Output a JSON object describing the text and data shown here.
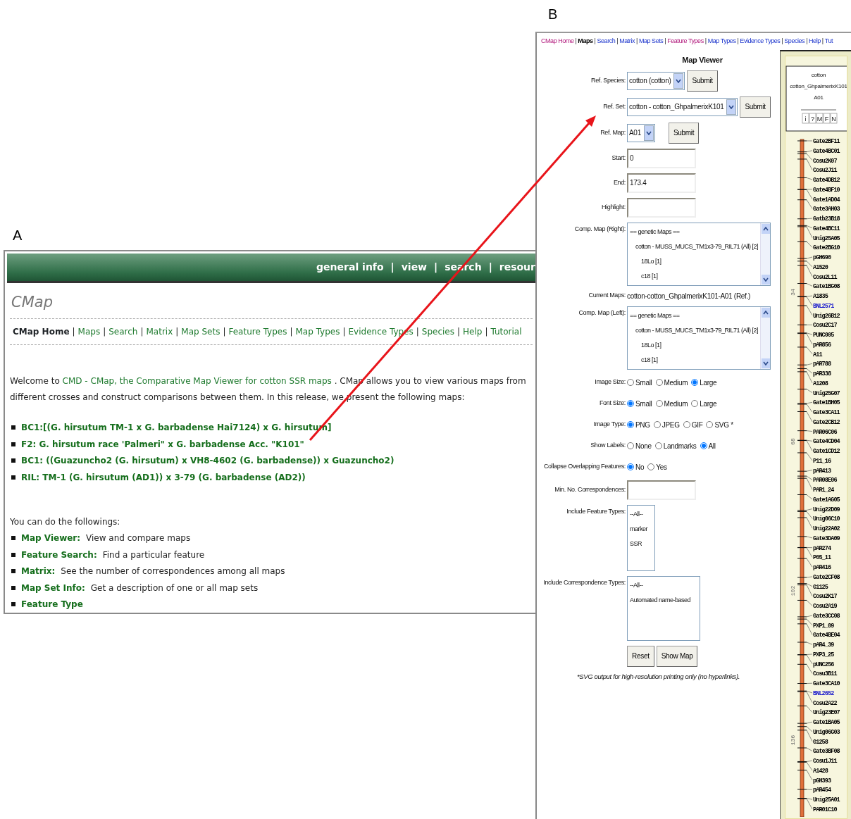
{
  "panel_a": {
    "label": "A",
    "header_nav": {
      "separator": "|",
      "items": [
        "general info",
        "view",
        "search",
        "resour"
      ]
    },
    "title": "CMap",
    "nav": {
      "separator": "|",
      "items": [
        {
          "text": "CMap Home",
          "selected": true
        },
        {
          "text": "Maps",
          "selected": false
        },
        {
          "text": "Search",
          "selected": false
        },
        {
          "text": "Matrix",
          "selected": false
        },
        {
          "text": "Map Sets",
          "selected": false
        },
        {
          "text": "Feature Types",
          "selected": false
        },
        {
          "text": "Map Types",
          "selected": false
        },
        {
          "text": "Evidence Types",
          "selected": false
        },
        {
          "text": "Species",
          "selected": false
        },
        {
          "text": "Help",
          "selected": false
        },
        {
          "text": "Tutorial",
          "selected": false
        }
      ]
    },
    "welcome": {
      "before": "Welcome to ",
      "link": "CMD - CMap, the Comparative Map Viewer for cotton SSR maps",
      "after": " . CMap allows you to view various maps from different crosses and construct comparisons between them. In this release, we present the following maps:"
    },
    "maps": [
      "BC1:[(G. hirsutum TM-1 x G. barbadense Hai7124) x G. hirsutum]",
      "F2: G. hirsutum race 'Palmeri\" x G. barbadense Acc. \"K101\"",
      "BC1: ((Guazuncho2 (G. hirsutum) x VH8-4602 (G. barbadense)) x Guazuncho2)",
      "RIL: TM-1 (G. hirsutum (AD1)) x 3-79 (G. barbadense (AD2))"
    ],
    "intro": "You can do the followings:",
    "features": [
      {
        "link": "Map Viewer:",
        "text": "View and compare maps"
      },
      {
        "link": "Feature Search:",
        "text": "Find a particular feature"
      },
      {
        "link": "Matrix:",
        "text": "See the number of correspondences among all maps"
      },
      {
        "link": "Map Set Info:",
        "text": "Get a description of one or all map sets"
      },
      {
        "link": "Feature Type"
      }
    ]
  },
  "panel_b": {
    "label": "B",
    "nav": {
      "separator": "|",
      "items": [
        {
          "text": "CMap Home",
          "kind": "visited"
        },
        {
          "text": "Maps",
          "kind": "current"
        },
        {
          "text": "Search",
          "kind": "link"
        },
        {
          "text": "Matrix",
          "kind": "link"
        },
        {
          "text": "Map Sets",
          "kind": "link"
        },
        {
          "text": "Feature Types",
          "kind": "visited"
        },
        {
          "text": "Map Types",
          "kind": "link"
        },
        {
          "text": "Evidence Types",
          "kind": "link"
        },
        {
          "text": "Species",
          "kind": "link"
        },
        {
          "text": "Help",
          "kind": "link"
        },
        {
          "text": "Tut",
          "kind": "link"
        }
      ]
    },
    "form": {
      "title": "Map Viewer",
      "rows": [
        {
          "kind": "select",
          "label": "Ref. Species:",
          "value": "cotton (cotton)",
          "button": "Submit"
        },
        {
          "kind": "select",
          "label": "Ref. Set:",
          "value": "cotton - cotton_GhpalmerixK101",
          "button": "Submit"
        },
        {
          "kind": "select",
          "label": "Ref. Map:",
          "value": "A01",
          "button": "Submit"
        },
        {
          "kind": "input",
          "label": "Start:",
          "value": "0"
        },
        {
          "kind": "input",
          "label": "End:",
          "value": "173.4"
        },
        {
          "kind": "input",
          "label": "Highlight:"
        },
        {
          "kind": "listbox",
          "label": "Comp. Map (Right):",
          "scrollbar": true,
          "options": [
            {
              "text": "== genetic Maps ==",
              "children": [
                {
                  "text": "cotton - MUSS_MUCS_TM1x3-79_RIL71 (All) [2]",
                  "children": [
                    {
                      "text": "18Lo [1]"
                    },
                    {
                      "text": "c18 [1]"
                    }
                  ]
                }
              ]
            }
          ]
        },
        {
          "kind": "text",
          "label": "Current Maps:",
          "value": "cotton-cotton_GhpalmerixK101-A01 (Ref.)"
        },
        {
          "kind": "listbox",
          "label": "Comp. Map (Left):",
          "scrollbar": true,
          "options": [
            {
              "text": "== genetic Maps ==",
              "children": [
                {
                  "text": "cotton - MUSS_MUCS_TM1x3-79_RIL71 (All) [2]",
                  "children": [
                    {
                      "text": "18Lo [1]"
                    },
                    {
                      "text": "c18 [1]"
                    }
                  ]
                }
              ]
            }
          ]
        },
        {
          "kind": "radios",
          "label": "Image Size:",
          "options": [
            {
              "text": "Small",
              "selected": false
            },
            {
              "text": "Medium",
              "selected": false
            },
            {
              "text": "Large",
              "selected": true
            }
          ]
        },
        {
          "kind": "radios",
          "label": "Font Size:",
          "options": [
            {
              "text": "Small",
              "selected": true
            },
            {
              "text": "Medium",
              "selected": false
            },
            {
              "text": "Large",
              "selected": false
            }
          ]
        },
        {
          "kind": "radios",
          "label": "Image Type:",
          "options": [
            {
              "text": "PNG",
              "selected": true
            },
            {
              "text": "JPEG",
              "selected": false
            },
            {
              "text": "GIF",
              "selected": false
            },
            {
              "text": "SVG *",
              "selected": false
            }
          ]
        },
        {
          "kind": "radios",
          "label": "Show Labels:",
          "options": [
            {
              "text": "None",
              "selected": false
            },
            {
              "text": "Landmarks",
              "selected": false
            },
            {
              "text": "All",
              "selected": true
            }
          ]
        },
        {
          "kind": "radios",
          "label": "Collapse Overlapping Features:",
          "options": [
            {
              "text": "No",
              "selected": true
            },
            {
              "text": "Yes",
              "selected": false
            }
          ]
        },
        {
          "kind": "input",
          "label": "Min. No. Correspondences:"
        },
        {
          "kind": "listbox",
          "label": "Include Feature Types:",
          "scrollbar": false,
          "options": [
            {
              "text": "--All--"
            },
            {
              "text": "marker"
            },
            {
              "text": "SSR"
            }
          ]
        },
        {
          "kind": "listbox",
          "label": "Include Correspondence Types:",
          "scrollbar": false,
          "options": [
            {
              "text": "--All--"
            },
            {
              "text": "Automated name-based"
            }
          ]
        },
        {
          "kind": "buttons",
          "buttons": [
            "Reset",
            "Show Map"
          ]
        },
        {
          "kind": "note",
          "text": "*SVG output for high-resolution printing only (no hyperlinks)."
        }
      ]
    },
    "map": {
      "header": [
        "cotton",
        "cotton_GhpalmerixK101",
        "A01"
      ],
      "buttons": [
        "i",
        "?",
        "M",
        "F",
        "N"
      ],
      "scale_labels": [
        "34",
        "68",
        "102",
        "136"
      ],
      "features": [
        {
          "name": "Gate2BF11",
          "color": "#000000"
        },
        {
          "name": "Gate4BC01",
          "color": "#000000"
        },
        {
          "name": "Cosu2K07",
          "color": "#000000"
        },
        {
          "name": "Cosu2J11",
          "color": "#000000"
        },
        {
          "name": "Gate4DB12",
          "color": "#000000"
        },
        {
          "name": "Gate4BF10",
          "color": "#000000"
        },
        {
          "name": "Gate1AD04",
          "color": "#000000"
        },
        {
          "name": "Gate3AH03",
          "color": "#000000"
        },
        {
          "name": "Gatb23B18",
          "color": "#000000"
        },
        {
          "name": "Gate4BC11",
          "color": "#000000"
        },
        {
          "name": "Unig25A05",
          "color": "#000000"
        },
        {
          "name": "Gate2BG10",
          "color": "#000000"
        },
        {
          "name": "pGH690",
          "color": "#000000"
        },
        {
          "name": "A1520",
          "color": "#000000"
        },
        {
          "name": "Cosu2L11",
          "color": "#000000"
        },
        {
          "name": "Gate1BG08",
          "color": "#000000"
        },
        {
          "name": "A1835",
          "color": "#000000"
        },
        {
          "name": "BNL2571",
          "color": "#1a1acc"
        },
        {
          "name": "Unig26B12",
          "color": "#000000"
        },
        {
          "name": "Cosu2C17",
          "color": "#000000"
        },
        {
          "name": "PUNC005",
          "color": "#000000"
        },
        {
          "name": "pAR856",
          "color": "#000000"
        },
        {
          "name": "A11",
          "color": "#000000"
        },
        {
          "name": "pAR788",
          "color": "#000000"
        },
        {
          "name": "pAR338",
          "color": "#000000"
        },
        {
          "name": "A1208",
          "color": "#000000"
        },
        {
          "name": "Unig25G07",
          "color": "#000000"
        },
        {
          "name": "Gate1BH05",
          "color": "#000000"
        },
        {
          "name": "Gate3CA11",
          "color": "#000000"
        },
        {
          "name": "Gate2CB12",
          "color": "#000000"
        },
        {
          "name": "PAR06C06",
          "color": "#000000"
        },
        {
          "name": "Gate4CD04",
          "color": "#000000"
        },
        {
          "name": "Gate1CD12",
          "color": "#000000"
        },
        {
          "name": "P11_16",
          "color": "#000000"
        },
        {
          "name": "pAR413",
          "color": "#000000"
        },
        {
          "name": "PAR08E06",
          "color": "#000000"
        },
        {
          "name": "PAR1_24",
          "color": "#000000"
        },
        {
          "name": "Gate1AG05",
          "color": "#000000"
        },
        {
          "name": "Unig22D09",
          "color": "#000000"
        },
        {
          "name": "Unig06C10",
          "color": "#000000"
        },
        {
          "name": "Unig22A02",
          "color": "#000000"
        },
        {
          "name": "Gate3DA09",
          "color": "#000000"
        },
        {
          "name": "pAR274",
          "color": "#000000"
        },
        {
          "name": "P05_11",
          "color": "#000000"
        },
        {
          "name": "pAR416",
          "color": "#000000"
        },
        {
          "name": "Gate2CF08",
          "color": "#000000"
        },
        {
          "name": "G1125",
          "color": "#000000"
        },
        {
          "name": "Cosu2K17",
          "color": "#000000"
        },
        {
          "name": "Cosu2A19",
          "color": "#000000"
        },
        {
          "name": "Gate3CC08",
          "color": "#000000"
        },
        {
          "name": "PXP1_09",
          "color": "#000000"
        },
        {
          "name": "Gate4BE04",
          "color": "#000000"
        },
        {
          "name": "pAR4_39",
          "color": "#000000"
        },
        {
          "name": "PXP3_25",
          "color": "#000000"
        },
        {
          "name": "pUNC256",
          "color": "#000000"
        },
        {
          "name": "Cosu3B11",
          "color": "#000000"
        },
        {
          "name": "Gate3CA10",
          "color": "#000000"
        },
        {
          "name": "BNL2652",
          "color": "#1a1acc"
        },
        {
          "name": "Cosu2A22",
          "color": "#000000"
        },
        {
          "name": "Unig23E07",
          "color": "#000000"
        },
        {
          "name": "Gate1BA05",
          "color": "#000000"
        },
        {
          "name": "Unig06G03",
          "color": "#000000"
        },
        {
          "name": "G1258",
          "color": "#000000"
        },
        {
          "name": "Gate3BF08",
          "color": "#000000"
        },
        {
          "name": "Cosu1J11",
          "color": "#000000"
        },
        {
          "name": "A1428",
          "color": "#000000"
        },
        {
          "name": "pGH393",
          "color": "#000000"
        },
        {
          "name": "pAR454",
          "color": "#000000"
        },
        {
          "name": "Unig25A01",
          "color": "#000000"
        },
        {
          "name": "PAR01C10",
          "color": "#000000"
        }
      ]
    }
  }
}
